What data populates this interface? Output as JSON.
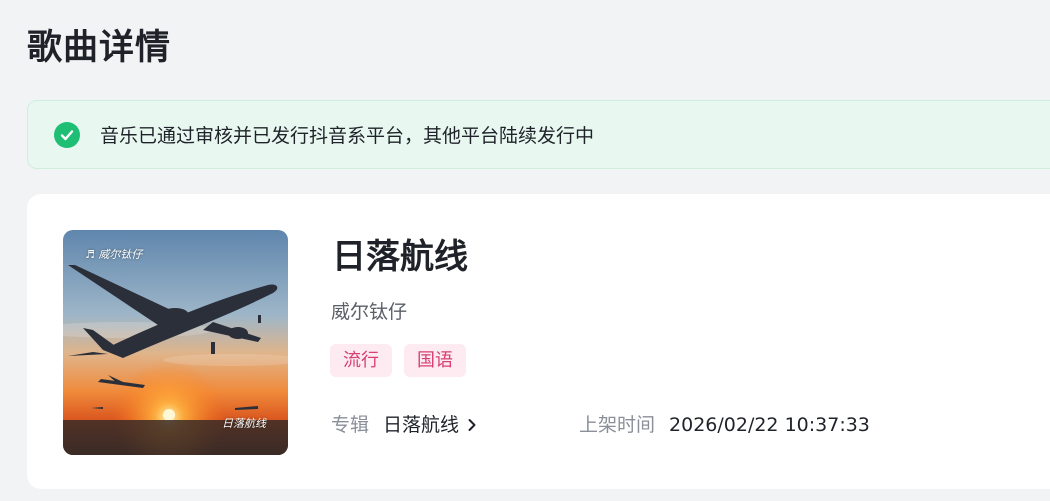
{
  "page": {
    "title": "歌曲详情"
  },
  "notice": {
    "icon": "check-circle-icon",
    "text": "音乐已通过审核并已发行抖音系平台，其他平台陆续发行中",
    "color": "#1fbe75"
  },
  "song": {
    "title": "日落航线",
    "artist": "威尔钛仔",
    "cover": {
      "caption_top": "♬ 威尔钛仔",
      "caption_bottom": "日落航线"
    },
    "tags": [
      "流行",
      "国语"
    ],
    "album": {
      "label": "专辑",
      "value": "日落航线",
      "icon": "chevron-right-icon"
    },
    "release": {
      "label": "上架时间",
      "value": "2026/02/22 10:37:33"
    }
  },
  "colors": {
    "tag_bg": "#fdebf1",
    "tag_text": "#d83f74",
    "background": "#f2f3f5"
  }
}
